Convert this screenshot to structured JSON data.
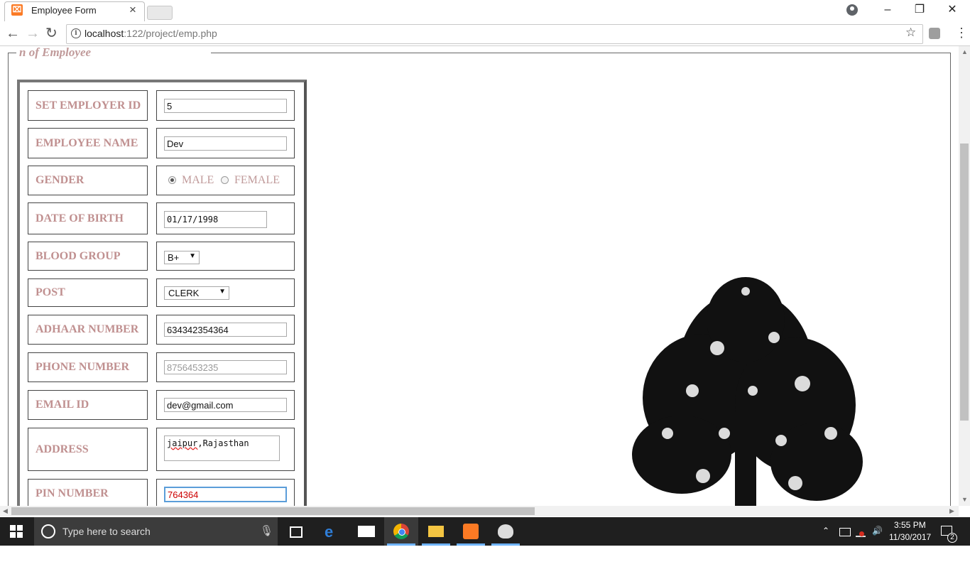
{
  "browser": {
    "tab_title": "Employee Form",
    "tab_favicon_glyph": "⌧",
    "url_host": "localhost",
    "url_path": ":122/project/emp.php",
    "icons": [
      "back-arrow-icon",
      "forward-arrow-icon",
      "reload-icon",
      "info-icon",
      "star-icon",
      "extension-icon",
      "menu-icon"
    ]
  },
  "page": {
    "legend": "n of Employee",
    "fields": {
      "employer_id": {
        "label": "SET EMPLOYER ID",
        "value": "5"
      },
      "employee_name": {
        "label": "EMPLOYEE NAME",
        "value": "Dev"
      },
      "gender": {
        "label": "GENDER",
        "options": [
          "MALE",
          "FEMALE"
        ],
        "selected": "MALE"
      },
      "dob": {
        "label": "DATE OF BIRTH",
        "value": "01/17/1998"
      },
      "blood_group": {
        "label": "BLOOD GROUP",
        "value": "B+"
      },
      "post": {
        "label": "POST",
        "value": "CLERK"
      },
      "adhaar": {
        "label": "ADHAAR NUMBER",
        "value": "634342354364"
      },
      "phone": {
        "label": "PHONE NUMBER",
        "value": "8756453235"
      },
      "email": {
        "label": "EMAIL ID",
        "value": "dev@gmail.com"
      },
      "address": {
        "label": "ADDRESS",
        "value_word1": "jaipur",
        "value_rest": ",Rajasthan"
      },
      "pin": {
        "label": "PIN NUMBER",
        "value": "764364"
      }
    }
  },
  "taskbar": {
    "search_placeholder": "Type here to search",
    "time": "3:55 PM",
    "date": "11/30/2017",
    "notification_count": "2"
  },
  "colors": {
    "label_text": "#c09090",
    "accent_focus": "#5b9dd9",
    "taskbar_bg": "#1f1f1f"
  }
}
